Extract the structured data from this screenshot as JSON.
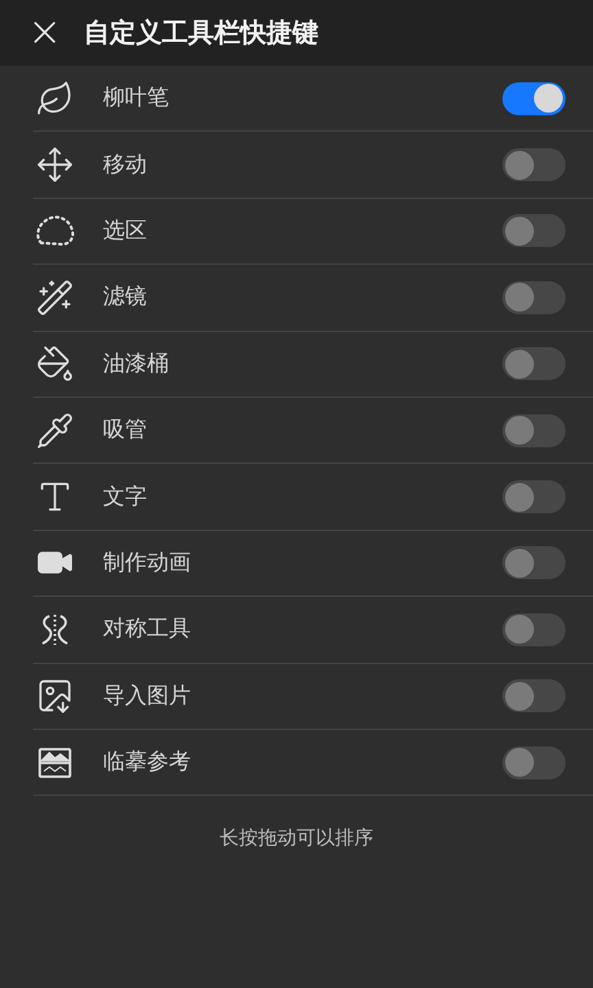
{
  "header": {
    "close": "×",
    "title": "自定义工具栏快捷键"
  },
  "tools": [
    {
      "label": "柳叶笔",
      "on": true
    },
    {
      "label": "移动",
      "on": false
    },
    {
      "label": "选区",
      "on": false
    },
    {
      "label": "滤镜",
      "on": false
    },
    {
      "label": "油漆桶",
      "on": false
    },
    {
      "label": "吸管",
      "on": false
    },
    {
      "label": "文字",
      "on": false
    },
    {
      "label": "制作动画",
      "on": false
    },
    {
      "label": "对称工具",
      "on": false
    },
    {
      "label": "导入图片",
      "on": false
    },
    {
      "label": "临摹参考",
      "on": false
    }
  ],
  "hint": "长按拖动可以排序"
}
